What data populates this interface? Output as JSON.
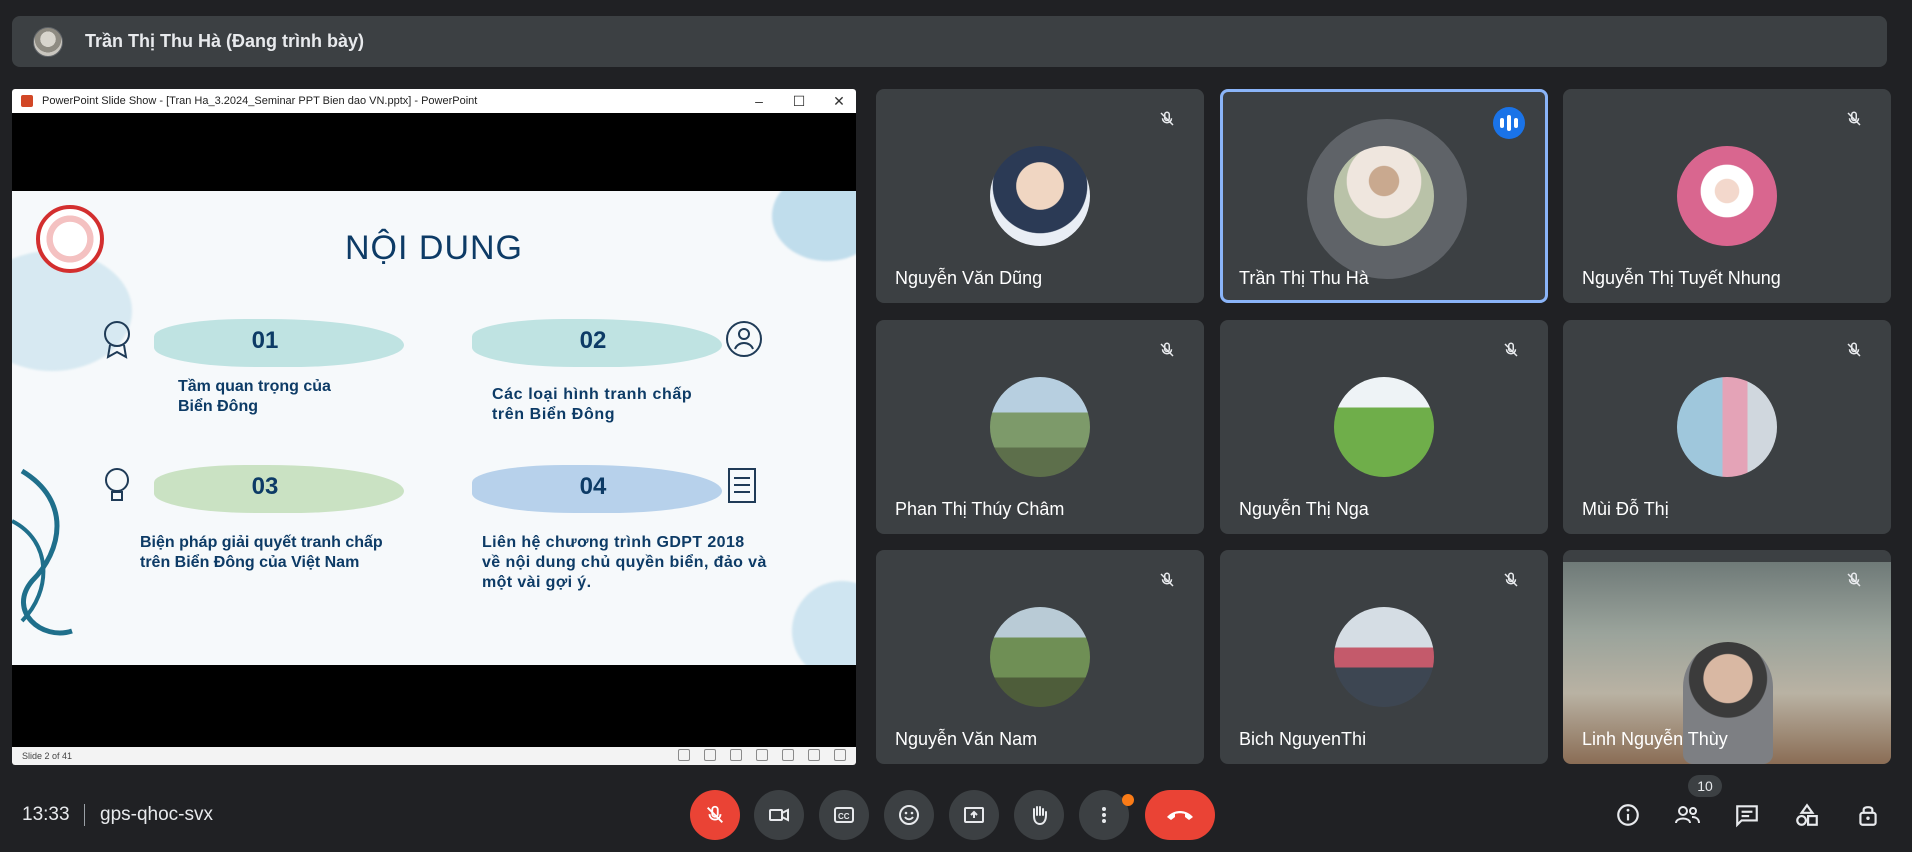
{
  "banner": {
    "presenter_title": "Trần Thị Thu Hà (Đang trình bày)"
  },
  "presentation": {
    "window_title": "PowerPoint Slide Show - [Tran Ha_3.2024_Seminar PPT Bien dao VN.pptx] - PowerPoint",
    "slide_counter": "Slide 2 of 41",
    "slide": {
      "heading": "NỘI DUNG",
      "items": [
        {
          "number": "01",
          "text_lines": [
            "Tầm quan trọng của",
            "Biển Đông"
          ]
        },
        {
          "number": "02",
          "text_lines": [
            "Các loại hình tranh chấp",
            "trên Biển Đông"
          ]
        },
        {
          "number": "03",
          "text_lines": [
            "Biện pháp giải quyết tranh chấp",
            "trên Biển Đông của Việt Nam"
          ]
        },
        {
          "number": "04",
          "text_lines": [
            "Liên hệ chương trình GDPT 2018",
            "về nội dung chủ quyền biển, đảo và",
            "một vài gợi ý."
          ]
        }
      ]
    }
  },
  "participants": [
    {
      "name": "Nguyễn Văn Dũng",
      "muted": true,
      "avatar_color": "#cfd8e6"
    },
    {
      "name": "Trần Thị Thu Hà",
      "muted": false,
      "speaking": true,
      "avatar_color": "#d8d5cd"
    },
    {
      "name": "Nguyễn Thị Tuyết Nhung",
      "muted": true,
      "avatar_color": "#d9668f"
    },
    {
      "name": "Phan Thị Thúy Châm",
      "muted": true,
      "avatar_color": "#7d9a6a"
    },
    {
      "name": "Nguyễn Thị Nga",
      "muted": true,
      "avatar_color": "#5f9a3c"
    },
    {
      "name": "Mùi Đỗ Thị",
      "muted": true,
      "avatar_color": "#6aa4c8"
    },
    {
      "name": "Nguyễn Văn Nam",
      "muted": true,
      "avatar_color": "#6f8f55"
    },
    {
      "name": "Bich NguyenThi",
      "muted": true,
      "avatar_color": "#6e7b8c"
    },
    {
      "name": "Linh Nguyễn Thùy",
      "muted": true,
      "video": true,
      "avatar_color": "#8a8f88"
    }
  ],
  "toolbar": {
    "time": "13:33",
    "meeting_code": "gps-qhoc-svx",
    "participant_count": "10"
  },
  "icons": {
    "mic": "mic-off-icon",
    "camera": "videocam-icon",
    "captions": "closed-caption-icon",
    "emoji": "emoji-icon",
    "present": "present-screen-icon",
    "raise_hand": "raise-hand-icon",
    "more": "more-vert-icon",
    "end_call": "call-end-icon",
    "info": "info-icon",
    "people": "people-icon",
    "chat": "chat-icon",
    "activities": "activities-icon",
    "host_controls": "lock-person-icon"
  },
  "colors": {
    "background": "#202124",
    "tile": "#3c4043",
    "accent_blue": "#8ab4f8",
    "danger_red": "#ea4335",
    "notification_orange": "#fa7b17"
  }
}
